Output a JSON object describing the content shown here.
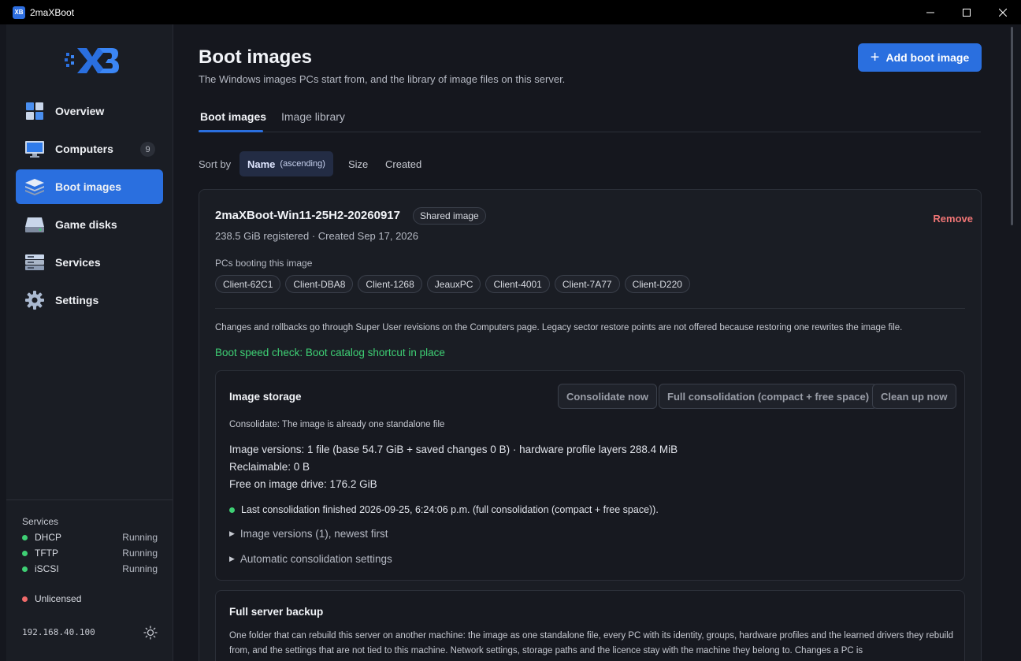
{
  "window": {
    "title": "2maXBoot",
    "icon_text": "XB"
  },
  "sidebar": {
    "items": [
      {
        "label": "Overview",
        "icon": "overview-tiles-icon"
      },
      {
        "label": "Computers",
        "icon": "monitor-icon",
        "badge": "9"
      },
      {
        "label": "Boot images",
        "icon": "stack-layers-icon",
        "active": true
      },
      {
        "label": "Game disks",
        "icon": "disk-drive-icon"
      },
      {
        "label": "Services",
        "icon": "server-rack-icon"
      },
      {
        "label": "Settings",
        "icon": "gear-icon"
      }
    ],
    "services_title": "Services",
    "services": [
      {
        "name": "DHCP",
        "state": "Running"
      },
      {
        "name": "TFTP",
        "state": "Running"
      },
      {
        "name": "iSCSI",
        "state": "Running"
      }
    ],
    "license": "Unlicensed",
    "ip": "192.168.40.100"
  },
  "header": {
    "title": "Boot images",
    "subtitle": "The Windows images PCs start from, and the library of image files on this server.",
    "add_button": "Add boot image"
  },
  "tabs": [
    {
      "label": "Boot images",
      "active": true
    },
    {
      "label": "Image library",
      "active": false
    }
  ],
  "sort": {
    "label": "Sort by",
    "options": [
      {
        "label": "Name",
        "qualifier": "(ascending)",
        "active": true
      },
      {
        "label": "Size"
      },
      {
        "label": "Created"
      }
    ]
  },
  "image": {
    "name": "2maXBoot-Win11-25H2-20260917",
    "badge": "Shared image",
    "remove": "Remove",
    "meta": "238.5 GiB registered · Created Sep 17, 2026",
    "pcs_label": "PCs booting this image",
    "pcs": [
      "Client-62C1",
      "Client-DBA8",
      "Client-1268",
      "JeauxPC",
      "Client-4001",
      "Client-7A77",
      "Client-D220"
    ],
    "note": "Changes and rollbacks go through Super User revisions on the Computers page. Legacy sector restore points are not offered because restoring one rewrites the image file.",
    "speed_check": "Boot speed check: Boot catalog shortcut in place"
  },
  "storage": {
    "title": "Image storage",
    "buttons": [
      "Consolidate now",
      "Full consolidation (compact + free space)",
      "Clean up now"
    ],
    "consolidate_note": "Consolidate: The image is already one standalone file",
    "versions_line": "Image versions: 1 file (base 54.7 GiB + saved changes 0 B) · hardware profile layers 288.4 MiB",
    "reclaimable": "Reclaimable: 0 B",
    "free": "Free on image drive: 176.2 GiB",
    "last_consolidation": "Last consolidation finished 2026-09-25, 6:24:06 p.m. (full consolidation (compact + free space)).",
    "versions_disclosure": "Image versions (1), newest first",
    "auto_disclosure": "Automatic consolidation settings"
  },
  "backup": {
    "title": "Full server backup",
    "description": "One folder that can rebuild this server on another machine: the image as one standalone file, every PC with its identity, groups, hardware profiles and the learned drivers they rebuild from, and the settings that are not tied to this machine. Network settings, storage paths and the licence stay with the machine they belong to. Changes a PC is"
  },
  "colors": {
    "accent": "#2a6fdf",
    "success": "#3ecf74",
    "danger": "#f07575",
    "background": "#15171e",
    "surface": "#1a1d24"
  }
}
